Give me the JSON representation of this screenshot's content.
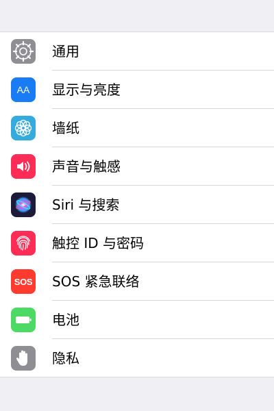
{
  "settings": {
    "items": [
      {
        "label": "通用",
        "icon": "gear-icon",
        "color": "#8e8e93"
      },
      {
        "label": "显示与亮度",
        "icon": "text-size-icon",
        "icon_text": "AA",
        "color": "#1a7cf5"
      },
      {
        "label": "墙纸",
        "icon": "flower-icon",
        "color": "#35aadc"
      },
      {
        "label": "声音与触感",
        "icon": "speaker-icon",
        "color": "#ff2d55"
      },
      {
        "label": "Siri 与搜索",
        "icon": "siri-icon",
        "color": "#1c1c3a"
      },
      {
        "label": "触控 ID 与密码",
        "icon": "fingerprint-icon",
        "color": "#ff2d55"
      },
      {
        "label": "SOS 紧急联络",
        "icon": "sos-icon",
        "icon_text": "SOS",
        "color": "#ff3b30"
      },
      {
        "label": "电池",
        "icon": "battery-icon",
        "color": "#4cd964"
      },
      {
        "label": "隐私",
        "icon": "hand-icon",
        "color": "#8e8e93"
      }
    ]
  }
}
